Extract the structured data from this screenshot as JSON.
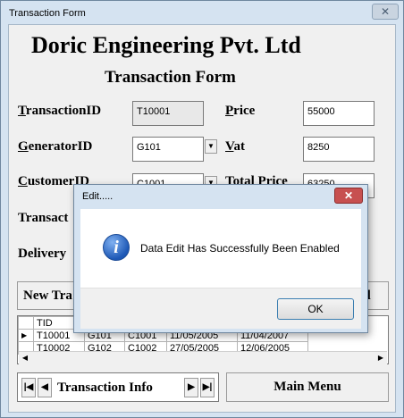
{
  "window": {
    "title": "Transaction Form",
    "close_glyph": "✕"
  },
  "header": {
    "company": "Doric Engineering Pvt. Ltd",
    "form_title": "Transaction Form"
  },
  "fields": {
    "transaction_id": {
      "label_key": "T",
      "label_rest": "ransactionID",
      "value": "T10001"
    },
    "generator_id": {
      "label_key": "G",
      "label_rest": "eneratorID",
      "value": "G101"
    },
    "customer_id": {
      "label_key": "C",
      "label_rest": "ustomerID",
      "value": "C1001"
    },
    "transaction_date": {
      "label": "Transact"
    },
    "delivery_date": {
      "label": "Delivery"
    },
    "price": {
      "label_key": "P",
      "label_rest": "rice",
      "value": "55000"
    },
    "vat": {
      "label_key": "V",
      "label_rest": "at",
      "value": "8250"
    },
    "total_price": {
      "label": "Total Price",
      "value": "63250"
    }
  },
  "buttons": {
    "new_transaction": "New Tra",
    "cancel": "el"
  },
  "grid": {
    "header": [
      "TID"
    ],
    "rows": [
      {
        "marker": "▶",
        "cells": [
          "T10001",
          "G101",
          "C1001",
          "11/05/2005",
          "11/04/2007"
        ]
      },
      {
        "marker": "",
        "cells": [
          "T10002",
          "G102",
          "C1002",
          "27/05/2005",
          "12/06/2005"
        ]
      }
    ]
  },
  "nav": {
    "first": "|◀",
    "prev": "◀",
    "label": "Transaction Info",
    "next": "▶",
    "last": "▶|"
  },
  "main_menu": "Main Menu",
  "dialog": {
    "title": "Edit.....",
    "close_glyph": "✕",
    "icon": "info-icon",
    "icon_glyph": "i",
    "message": "Data Edit Has Successfully Been Enabled",
    "ok": "OK"
  }
}
